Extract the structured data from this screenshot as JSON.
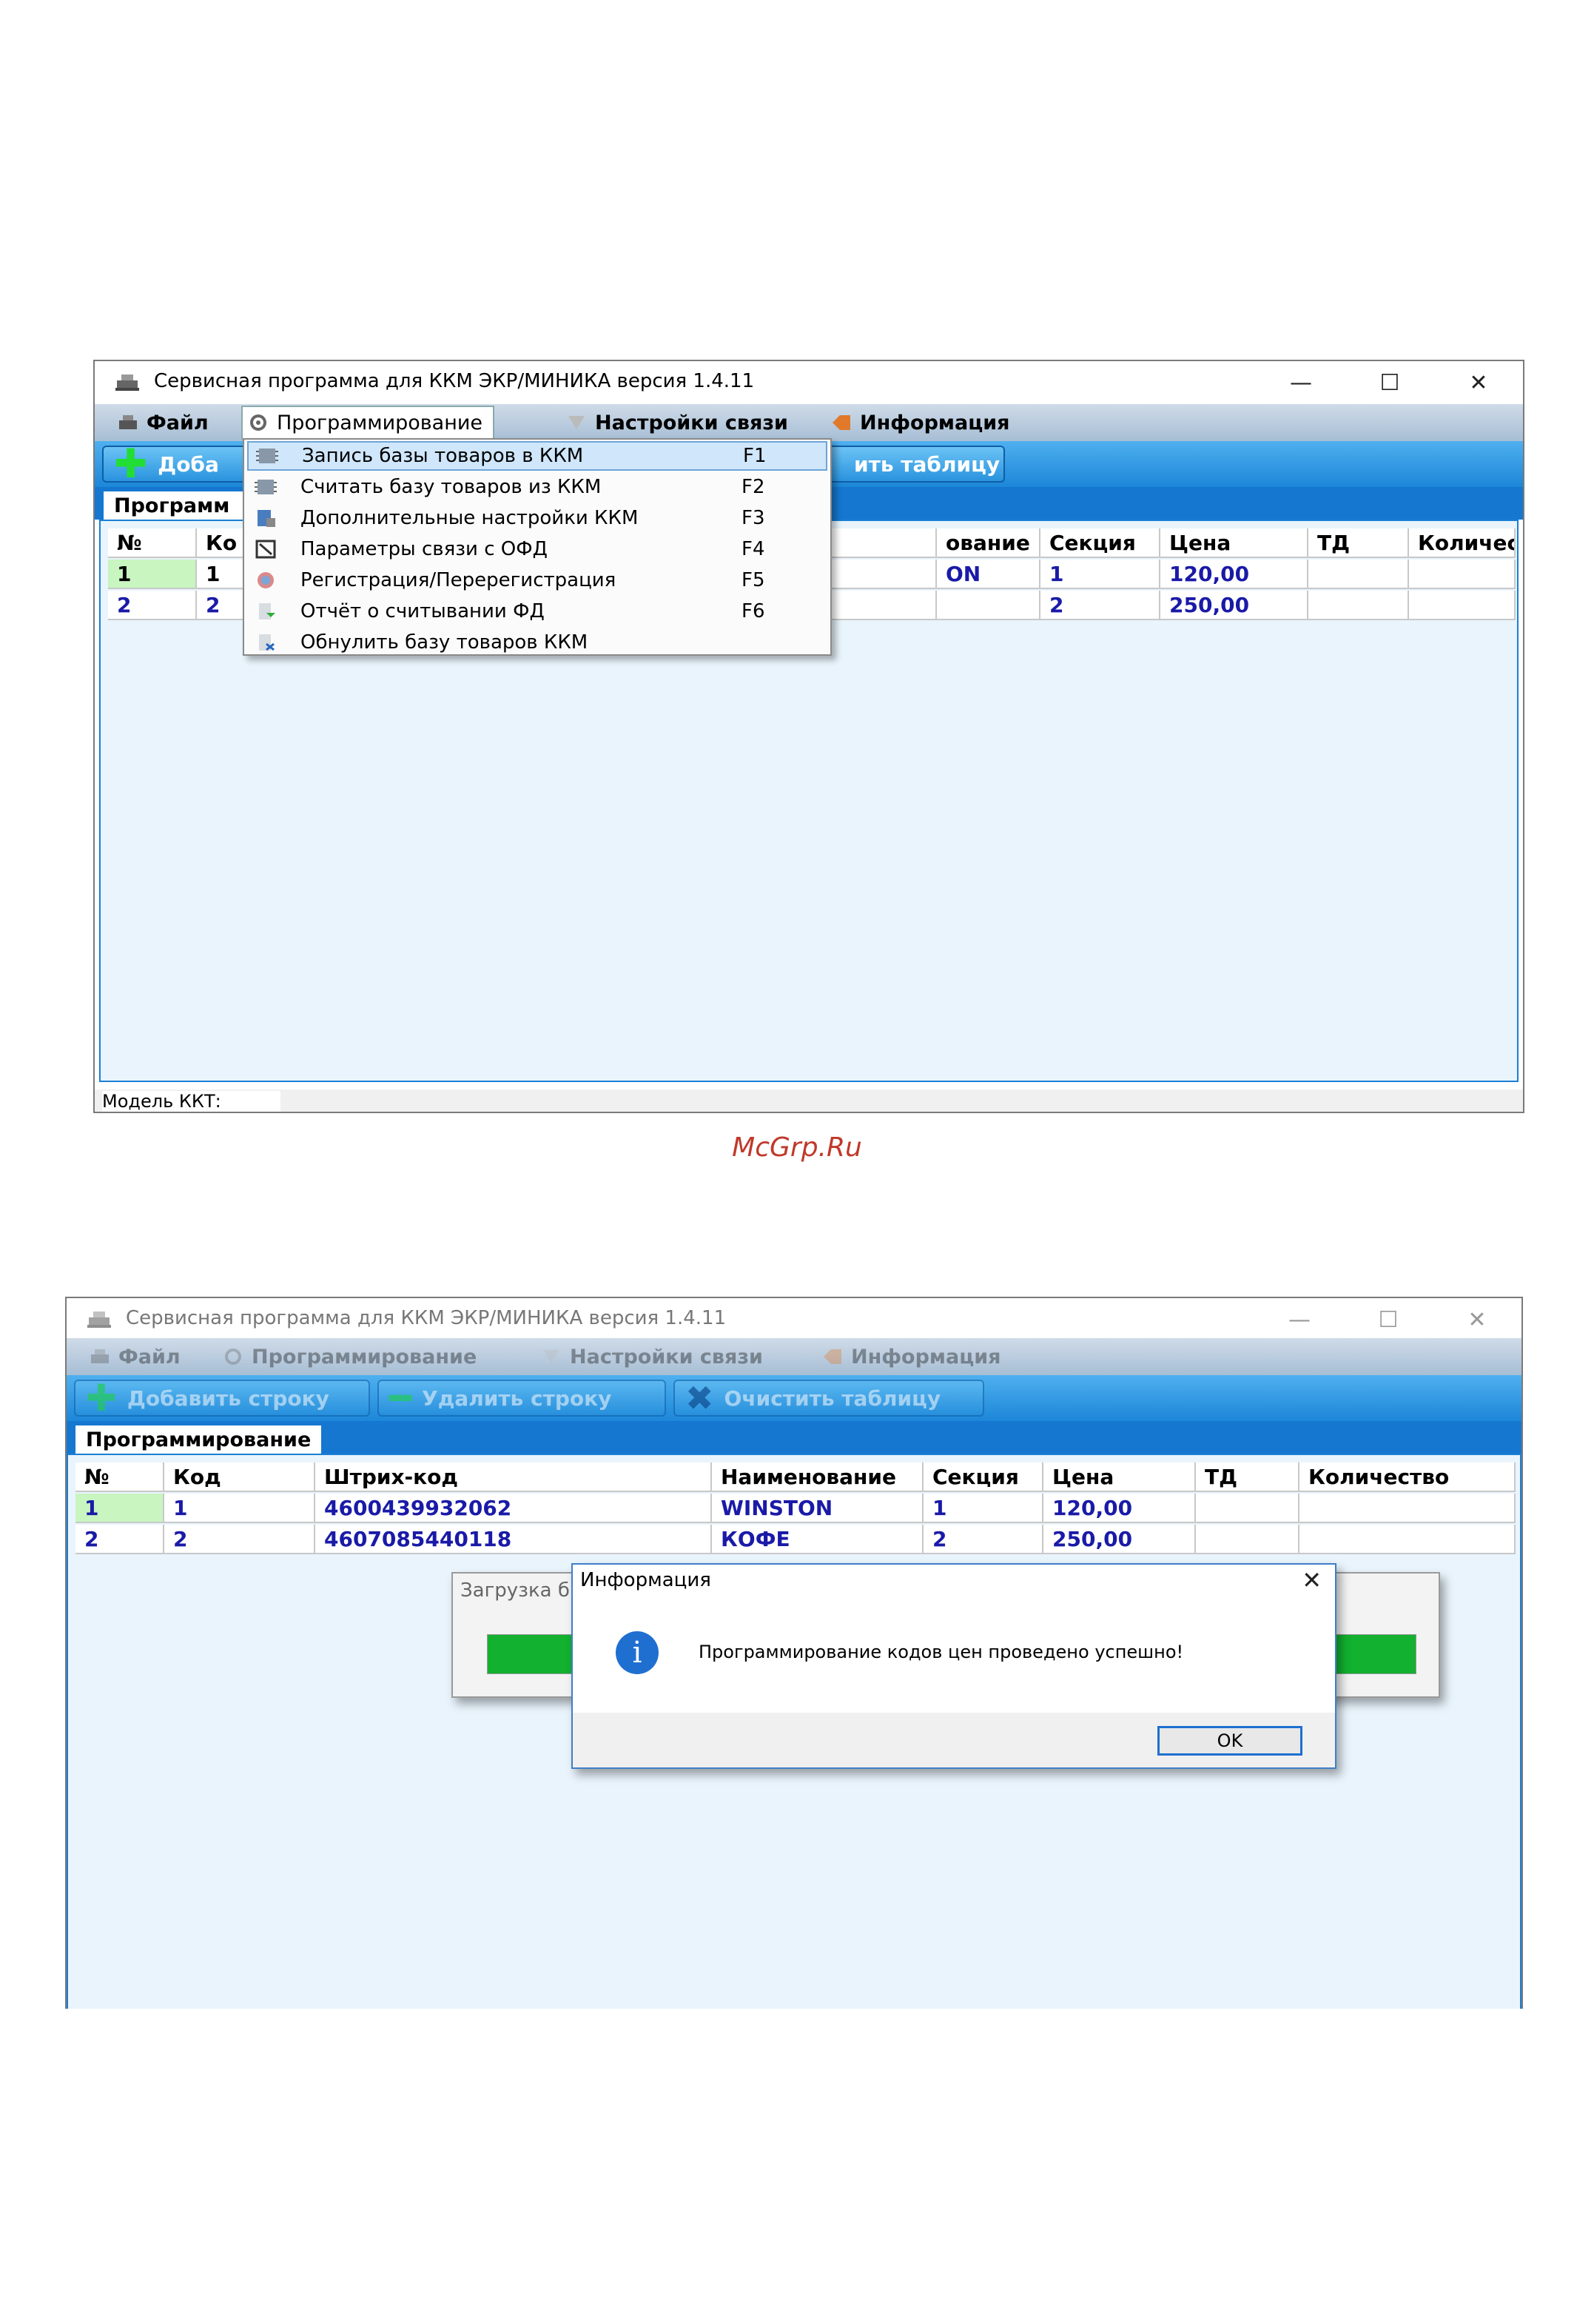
{
  "window1": {
    "title": "Сервисная программа для ККМ ЭКР/МИНИКА версия 1.4.11",
    "controls": {
      "minimize": "—",
      "maximize": "☐",
      "close": "✕"
    },
    "menu": {
      "file": "Файл",
      "programming": "Программирование",
      "connection": "Настройки связи",
      "info": "Информация"
    },
    "toolbar": {
      "add_partial": "Доба",
      "clear_partial": "ить таблицу"
    },
    "tab_partial": "Программ",
    "columns_partial": {
      "num": "№",
      "code": "Ко",
      "name": "ование",
      "section": "Секция",
      "price": "Цена",
      "td": "ТД",
      "qty": "Количество"
    },
    "rows": [
      {
        "num": "1",
        "code": "1",
        "name": "ON",
        "section": "1",
        "price": "120,00"
      },
      {
        "num": "2",
        "code": "2",
        "name": "",
        "section": "2",
        "price": "250,00"
      }
    ],
    "dropdown": [
      {
        "label": "Запись базы товаров в ККМ",
        "key": "F1"
      },
      {
        "label": "Считать базу товаров из ККМ",
        "key": "F2"
      },
      {
        "label": "Дополнительные настройки ККМ",
        "key": "F3"
      },
      {
        "label": "Параметры связи с ОФД",
        "key": "F4"
      },
      {
        "label": "Регистрация/Перерегистрация",
        "key": "F5"
      },
      {
        "label": "Отчёт о считывании ФД",
        "key": "F6"
      },
      {
        "label": "Обнулить базу товаров ККМ",
        "key": ""
      }
    ],
    "status": {
      "model_label": "Модель ККТ:"
    }
  },
  "watermark": "McGrp.Ru",
  "window2": {
    "title": "Сервисная программа для ККМ ЭКР/МИНИКА версия 1.4.11",
    "controls": {
      "minimize": "—",
      "maximize": "☐",
      "close": "✕"
    },
    "menu": {
      "file": "Файл",
      "programming": "Программирование",
      "connection": "Настройки связи",
      "info": "Информация"
    },
    "toolbar": {
      "add": "Добавить строку",
      "delete": "Удалить строку",
      "clear": "Очистить таблицу"
    },
    "tab": "Программирование",
    "columns": {
      "num": "№",
      "code": "Код",
      "barcode": "Штрих-код",
      "name": "Наименование",
      "section": "Секция",
      "price": "Цена",
      "td": "ТД",
      "qty": "Количество"
    },
    "rows": [
      {
        "num": "1",
        "code": "1",
        "barcode": "4600439932062",
        "name": "WINSTON",
        "section": "1",
        "price": "120,00"
      },
      {
        "num": "2",
        "code": "2",
        "barcode": "4607085440118",
        "name": "КОФЕ",
        "section": "2",
        "price": "250,00"
      }
    ],
    "progress_dialog": {
      "title_partial": "Загрузка б",
      "progress": 1.0
    },
    "info_dialog": {
      "title": "Информация",
      "close": "✕",
      "icon": "i",
      "message": "Программирование кодов цен проведено успешно!",
      "ok": "OK"
    }
  },
  "colors": {
    "accent": "#1577d0",
    "grid_bg": "#e9f4fc",
    "progress": "#12b12f",
    "price_text": "#1a1aa8"
  }
}
